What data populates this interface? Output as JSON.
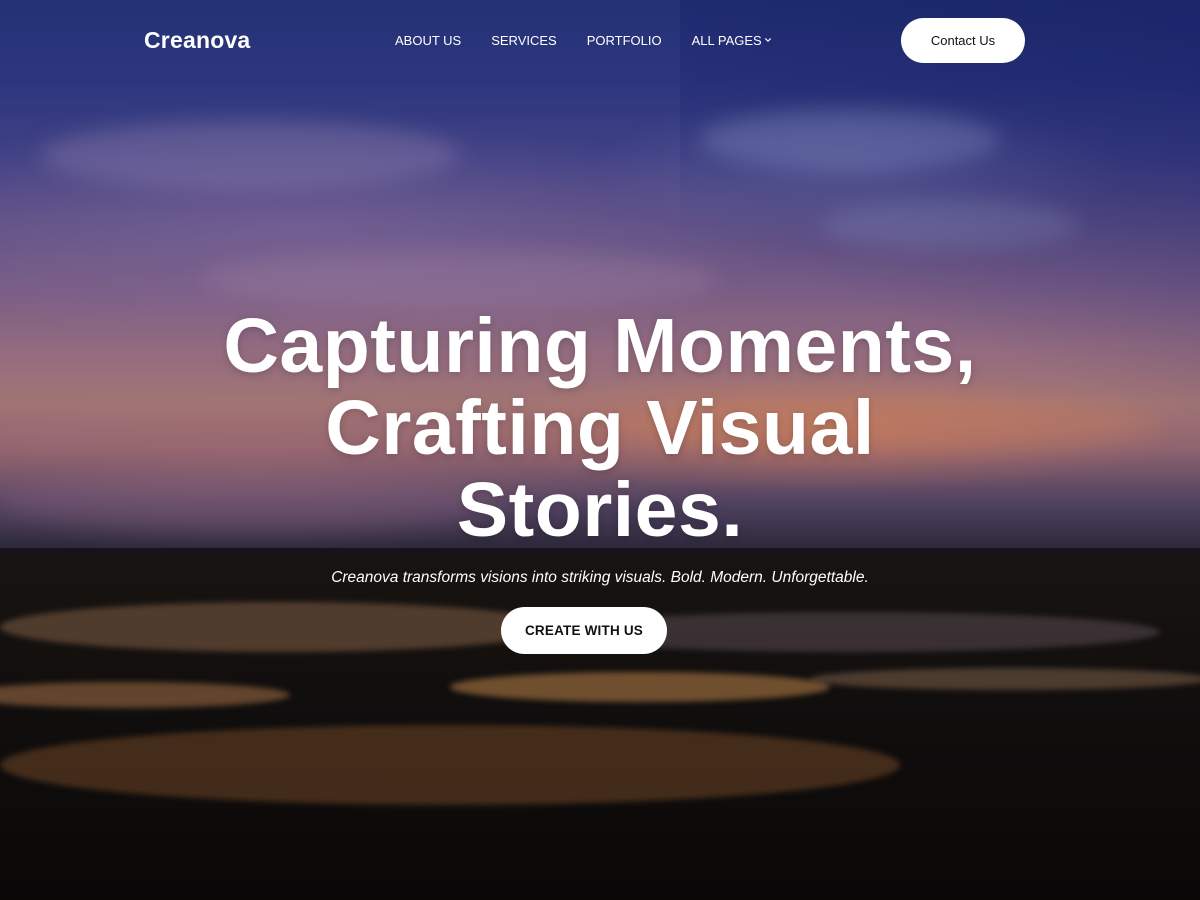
{
  "brand": {
    "name": "Creanova"
  },
  "nav": {
    "items": [
      {
        "label": "ABOUT US"
      },
      {
        "label": "SERVICES"
      },
      {
        "label": "PORTFOLIO"
      },
      {
        "label": "ALL PAGES",
        "icon": "chevron-down-icon"
      }
    ],
    "contact_label": "Contact Us"
  },
  "hero": {
    "headline_lines": [
      "Capturing Moments,",
      "Crafting Visual",
      "Stories."
    ],
    "subtitle": "Creanova transforms visions into striking visuals. Bold. Modern. Unforgettable.",
    "cta_label": "CREATE WITH US",
    "background": "sunset-over-tidal-flats-image"
  },
  "colors": {
    "text": "#ffffff",
    "button_bg": "#ffffff",
    "button_text": "#111111",
    "sky_top": "#2a3a86",
    "sky_glow": "#e88c64"
  }
}
